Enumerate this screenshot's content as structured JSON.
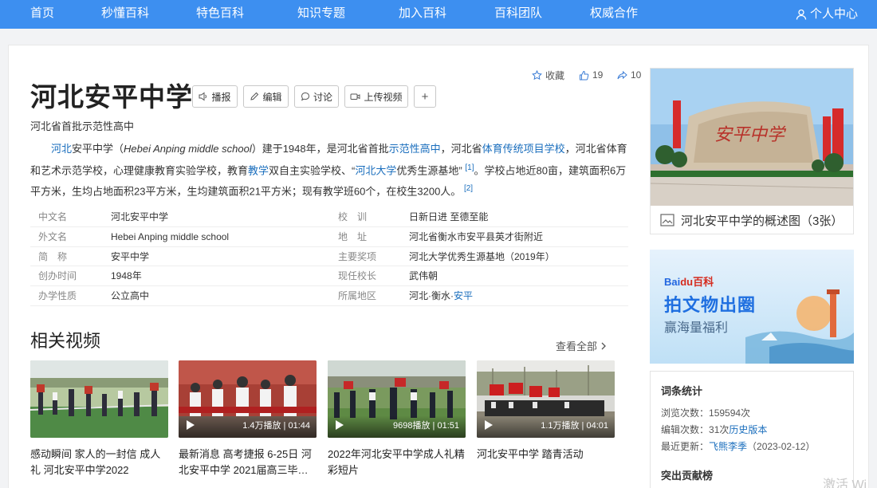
{
  "nav": {
    "items": [
      "首页",
      "秒懂百科",
      "特色百科",
      "知识专题",
      "加入百科",
      "百科团队",
      "权威合作"
    ],
    "user": "个人中心"
  },
  "entry": {
    "title": "河北安平中学",
    "buttons": {
      "voice": "播报",
      "edit": "编辑",
      "discuss": "讨论",
      "upload": "上传视频",
      "add": "+"
    },
    "collect": "收藏",
    "likes": "19",
    "shares": "10",
    "subtitle": "河北省首批示范性高中"
  },
  "summary": {
    "p1": "河北",
    "p2": "安平中学（",
    "p3": "Hebei Anping middle school",
    "p4": "）建于1948年，是河北省首批",
    "p5": "示范性高中",
    "p6": "，河北省",
    "p7": "体育传统项目学校",
    "p8": "，河北省体育和艺术示范学校，心理健康教育实验学校，教育",
    "p9": "教学",
    "p10": "双自主实验学校、“",
    "p11": "河北大学",
    "p12": "优秀生源基地”",
    "ref1": "[1]",
    "p13": "。学校占地近80亩，建筑面积6万平方米，生均占地面积23平方米，生均建筑面积21平方米；现有教学班60个，在校生3200人。",
    "ref2": "[2]"
  },
  "info": {
    "rows": [
      {
        "k1": "中文名",
        "v1": "河北安平中学",
        "k2": "校　训",
        "v2": "日新日进 至德至能"
      },
      {
        "k1": "外文名",
        "v1": "Hebei Anping middle school",
        "k2": "地　址",
        "v2": "河北省衡水市安平县英才街附近"
      },
      {
        "k1": "简　称",
        "v1": "安平中学",
        "k2": "主要奖项",
        "v2": "河北大学优秀生源基地（2019年）"
      },
      {
        "k1": "创办时间",
        "v1": "1948年",
        "k2": "现任校长",
        "v2": "武伟朝"
      },
      {
        "k1": "办学性质",
        "v1": "公立高中",
        "k2": "所属地区",
        "v2a": "河北·衡水·",
        "v2b": "安平"
      }
    ]
  },
  "videos": {
    "title": "相关视频",
    "see_all": "查看全部",
    "items": [
      {
        "meta": "",
        "caption": "感动瞬间 家人的一封信 成人礼 河北安平中学2022"
      },
      {
        "meta": "1.4万播放 | 01:44",
        "caption": "最新消息 高考捷报 6-25日 河北安平中学 2021届高三毕…"
      },
      {
        "meta": "9698播放 | 01:51",
        "caption": "2022年河北安平中学成人礼精彩短片"
      },
      {
        "meta": "1.1万播放 | 04:01",
        "caption": "河北安平中学 踏青活动"
      }
    ]
  },
  "album": {
    "sign": "安平中学",
    "caption": "河北安平中学的概述图（3张）"
  },
  "banner": {
    "logo_a": "Bai",
    "logo_b": "du",
    "logo_c": "百科",
    "headline": "拍文物出圈",
    "sub": "赢海量福利"
  },
  "stats": {
    "title": "词条统计",
    "views_label": "浏览次数：",
    "views": "159594次",
    "edits_label": "编辑次数：",
    "edits": "31次",
    "history": "历史版本",
    "updated_label": "最近更新：",
    "updated_by": "飞熊李季",
    "updated_date": "（2023-02-12）",
    "contrib": "突出贡献榜"
  },
  "watermark": "激活 Wi"
}
